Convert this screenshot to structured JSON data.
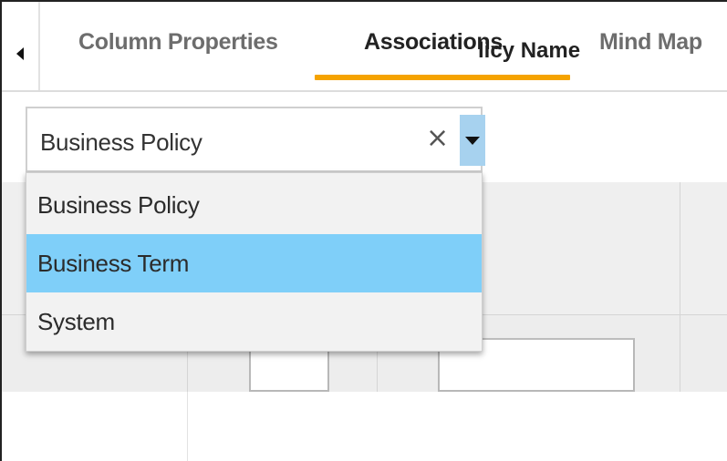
{
  "tabs": {
    "items": [
      {
        "label": "Column Properties",
        "active": false
      },
      {
        "label": "Associations",
        "active": true
      },
      {
        "label": "Mind Map",
        "active": false
      }
    ],
    "accent_color": "#f5a300"
  },
  "select": {
    "value": "Business Policy",
    "clear_glyph": "×",
    "options": [
      {
        "label": "Business Policy",
        "highlighted": false
      },
      {
        "label": "Business Term",
        "highlighted": true
      },
      {
        "label": "System",
        "highlighted": false
      }
    ],
    "highlight_color": "#7fcff9"
  },
  "table": {
    "column_header_visible": "licy Name"
  }
}
